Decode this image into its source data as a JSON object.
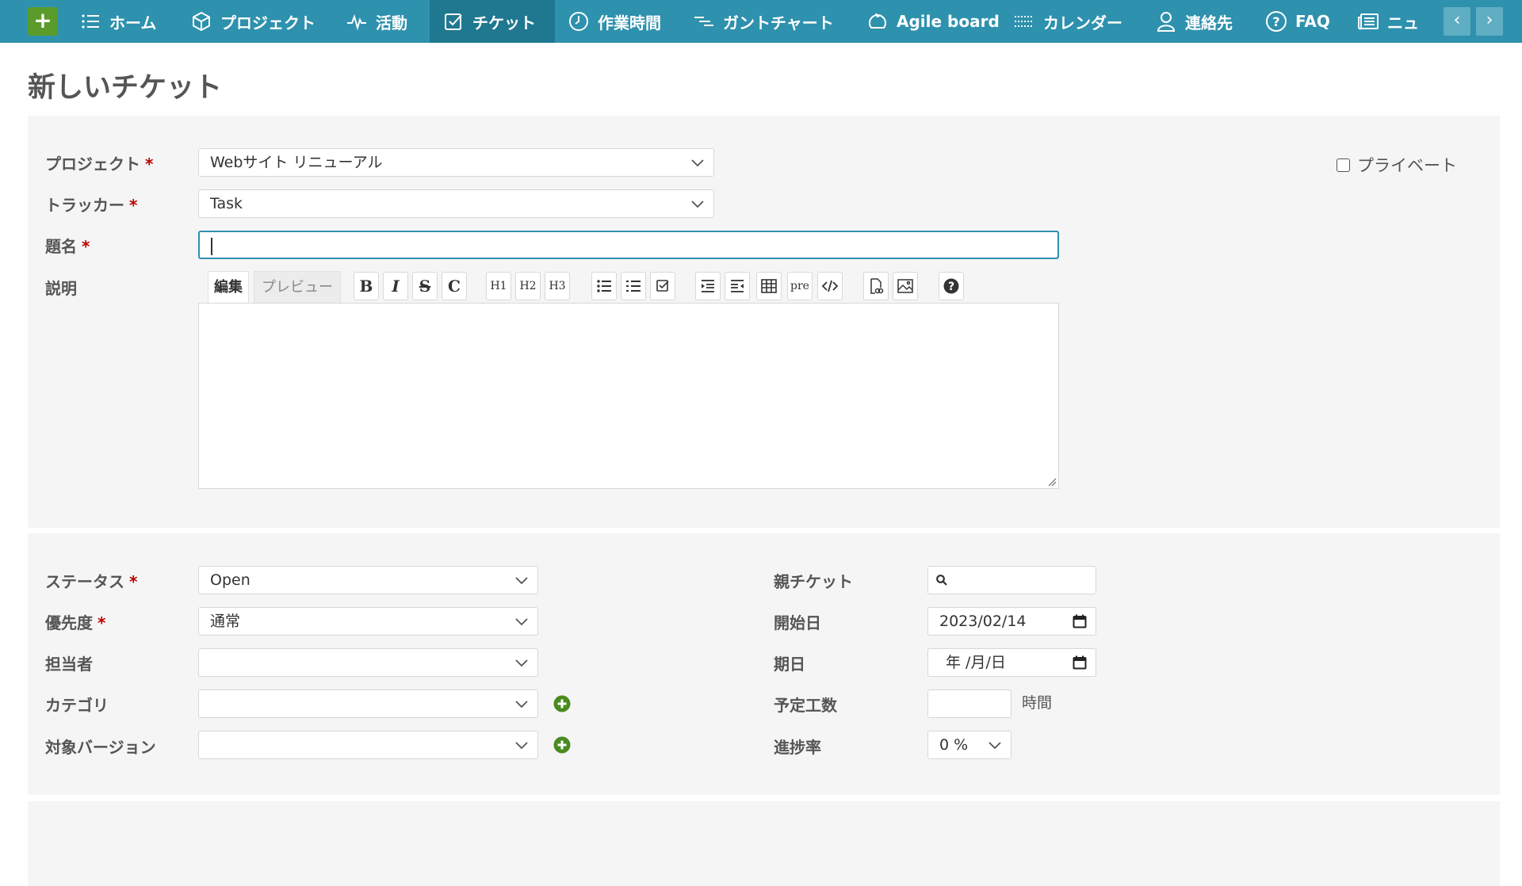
{
  "nav": {
    "add_label": "+",
    "items": [
      {
        "label": "ホーム",
        "icon": "list-icon"
      },
      {
        "label": "プロジェクト",
        "icon": "cube-icon"
      },
      {
        "label": "活動",
        "icon": "pulse-icon"
      },
      {
        "label": "チケット",
        "icon": "checkbox-icon",
        "active": true
      },
      {
        "label": "作業時間",
        "icon": "clock-icon"
      },
      {
        "label": "ガントチャート",
        "icon": "gantt-icon"
      },
      {
        "label": "Agile board",
        "icon": "agile-icon"
      },
      {
        "label": "カレンダー",
        "icon": "calendar-icon"
      },
      {
        "label": "連絡先",
        "icon": "person-icon"
      },
      {
        "label": "FAQ",
        "icon": "help-circle-icon"
      },
      {
        "label": "ニュ",
        "icon": "news-icon"
      }
    ],
    "prev_label": "‹",
    "next_label": "›"
  },
  "page": {
    "title": "新しいチケット"
  },
  "form": {
    "project": {
      "label": "プロジェクト",
      "value": "Webサイト リニューアル"
    },
    "tracker": {
      "label": "トラッカー",
      "value": "Task"
    },
    "subject": {
      "label": "題名",
      "value": ""
    },
    "description": {
      "label": "説明"
    },
    "private_label": "プライベート",
    "required_mark": "*"
  },
  "editor": {
    "tab_edit": "編集",
    "tab_preview": "プレビュー",
    "buttons": {
      "bold": "B",
      "italic": "I",
      "strike": "S",
      "code": "C",
      "h1": "H1",
      "h2": "H2",
      "h3": "H3",
      "pre": "pre"
    }
  },
  "attributes": {
    "status": {
      "label": "ステータス",
      "value": "Open"
    },
    "priority": {
      "label": "優先度",
      "value": "通常"
    },
    "assignee": {
      "label": "担当者",
      "value": ""
    },
    "category": {
      "label": "カテゴリ",
      "value": ""
    },
    "version": {
      "label": "対象バージョン",
      "value": ""
    },
    "parent": {
      "label": "親チケット",
      "value": ""
    },
    "start_date": {
      "label": "開始日",
      "value": "2023/02/14"
    },
    "due_date": {
      "label": "期日",
      "value": "年 /月/日"
    },
    "estimated": {
      "label": "予定工数",
      "value": "",
      "unit": "時間"
    },
    "done_ratio": {
      "label": "進捗率",
      "value": "0 %"
    }
  },
  "colors": {
    "nav_bg": "#2e91ad",
    "nav_active": "#1f7890",
    "add_button": "#5a9b2c",
    "required": "#bb0000",
    "plus_icon": "#4a8a1f"
  }
}
